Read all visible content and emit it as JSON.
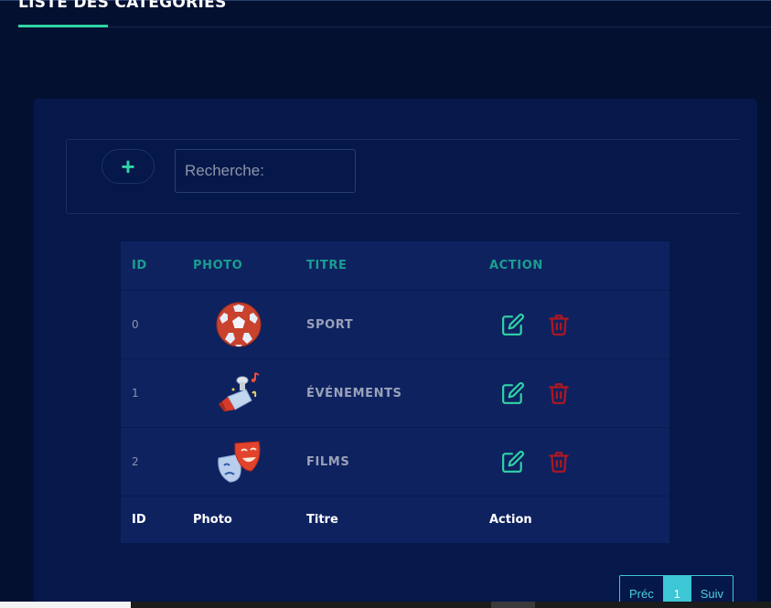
{
  "header": {
    "title": "LISTE DES CATÉGORIES"
  },
  "toolbar": {
    "add_label": "+",
    "search_placeholder": "Recherche:"
  },
  "table": {
    "columns": [
      "ID",
      "PHOTO",
      "TITRE",
      "ACTION"
    ],
    "rows": [
      {
        "id": "0",
        "title": "SPORT",
        "photo_icon": "soccer-ball-icon"
      },
      {
        "id": "1",
        "title": "ÉVÉNEMENTS",
        "photo_icon": "party-popper-icon"
      },
      {
        "id": "2",
        "title": "FILMS",
        "photo_icon": "theater-masks-icon"
      }
    ],
    "footer": [
      "ID",
      "Photo",
      "Titre",
      "Action"
    ],
    "action_icons": {
      "edit": "edit-icon",
      "delete": "trash-icon"
    }
  },
  "pagination": {
    "prev": "Préc",
    "current": "1",
    "next": "Suiv"
  },
  "colors": {
    "background": "#041030",
    "card": "#06184a",
    "table": "#0e2260",
    "accent": "#30d4a5",
    "header_text": "#1a9e8f",
    "delete": "#b0171f",
    "pagination": "#3cc6d6"
  }
}
